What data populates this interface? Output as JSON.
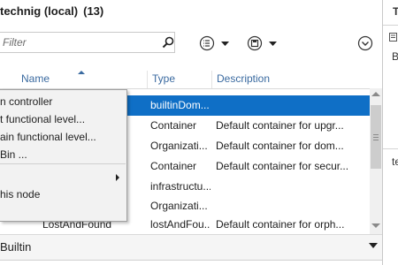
{
  "header": {
    "title": "technig (local)",
    "count": "(13)"
  },
  "filter": {
    "placeholder": "Filter"
  },
  "columns": {
    "name": "Name",
    "type": "Type",
    "description": "Description"
  },
  "rows": [
    {
      "name": "",
      "type": "builtinDom...",
      "description": ""
    },
    {
      "name": "",
      "type": "Container",
      "description": "Default container for upgr..."
    },
    {
      "name": "",
      "type": "Organizati...",
      "description": "Default container for dom..."
    },
    {
      "name": "",
      "type": "Container",
      "description": "Default container for secur..."
    },
    {
      "name": "",
      "type": "infrastructu...",
      "description": ""
    },
    {
      "name": "",
      "type": "Organizati...",
      "description": ""
    },
    {
      "name": "LostAndFound",
      "type": "lostAndFou...",
      "description": "Default container for orph..."
    }
  ],
  "context_menu": {
    "items": [
      {
        "label": "n controller"
      },
      {
        "label": "t functional level..."
      },
      {
        "label": "ain functional level..."
      },
      {
        "label": " Bin ..."
      },
      {
        "label": ""
      },
      {
        "label": "his node"
      }
    ]
  },
  "section": {
    "label": "Builtin"
  },
  "right_panel": {
    "title": "T",
    "label_b": "B",
    "label_te": "te"
  },
  "colors": {
    "selection": "#0f6fc6",
    "header_link": "#3a6aa0"
  },
  "icons": {
    "search": "search-icon",
    "list": "list-options-icon",
    "save": "save-icon",
    "expand": "expand-icon",
    "chevron": "chevron-down-icon"
  }
}
